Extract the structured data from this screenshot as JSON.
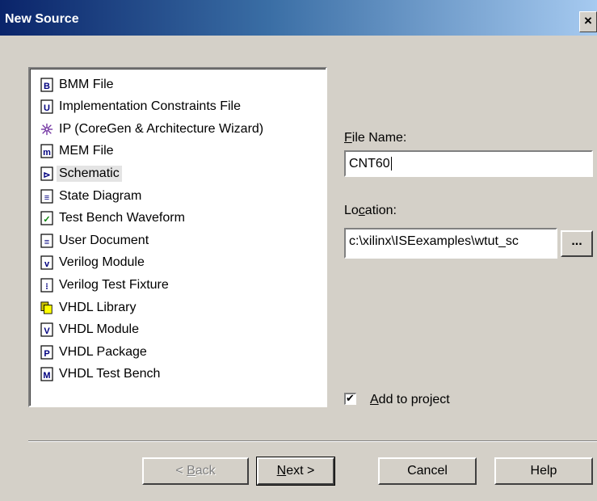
{
  "window": {
    "title": "New Source",
    "close_glyph": "×"
  },
  "source_types": [
    {
      "label": "BMM File",
      "icon": "bmm-file-icon"
    },
    {
      "label": "Implementation Constraints File",
      "icon": "constraints-file-icon"
    },
    {
      "label": "IP (CoreGen & Architecture Wizard)",
      "icon": "ip-wizard-icon"
    },
    {
      "label": "MEM File",
      "icon": "mem-file-icon"
    },
    {
      "label": "Schematic",
      "icon": "schematic-icon",
      "selected": true
    },
    {
      "label": "State Diagram",
      "icon": "state-diagram-icon"
    },
    {
      "label": "Test Bench Waveform",
      "icon": "test-bench-waveform-icon"
    },
    {
      "label": "User Document",
      "icon": "user-document-icon"
    },
    {
      "label": "Verilog Module",
      "icon": "verilog-module-icon"
    },
    {
      "label": "Verilog Test Fixture",
      "icon": "verilog-test-fixture-icon"
    },
    {
      "label": "VHDL Library",
      "icon": "vhdl-library-icon"
    },
    {
      "label": "VHDL Module",
      "icon": "vhdl-module-icon"
    },
    {
      "label": "VHDL Package",
      "icon": "vhdl-package-icon"
    },
    {
      "label": "VHDL Test Bench",
      "icon": "vhdl-test-bench-icon"
    }
  ],
  "file_name": {
    "label_prefix": "",
    "label_mnemonic": "F",
    "label_rest": "ile Name:",
    "value": "CNT60"
  },
  "location": {
    "label_prefix": "Lo",
    "label_mnemonic": "c",
    "label_rest": "ation:",
    "value": "c:\\xilinx\\ISEexamples\\wtut_sc",
    "browse_label": "..."
  },
  "add_to_project": {
    "mnemonic": "A",
    "rest": "dd to project",
    "checked": true,
    "check_glyph": "✔"
  },
  "buttons": {
    "back": {
      "prefix": "< ",
      "mnemonic": "B",
      "rest": "ack"
    },
    "next": {
      "prefix": "",
      "mnemonic": "N",
      "rest": "ext >"
    },
    "cancel": "Cancel",
    "help": "Help"
  },
  "colors": {
    "title_bar_start": "#0a246a",
    "title_bar_end": "#a6caf0",
    "dialog_bg": "#d4d0c8",
    "selection_bg": "#e4e4e4"
  }
}
